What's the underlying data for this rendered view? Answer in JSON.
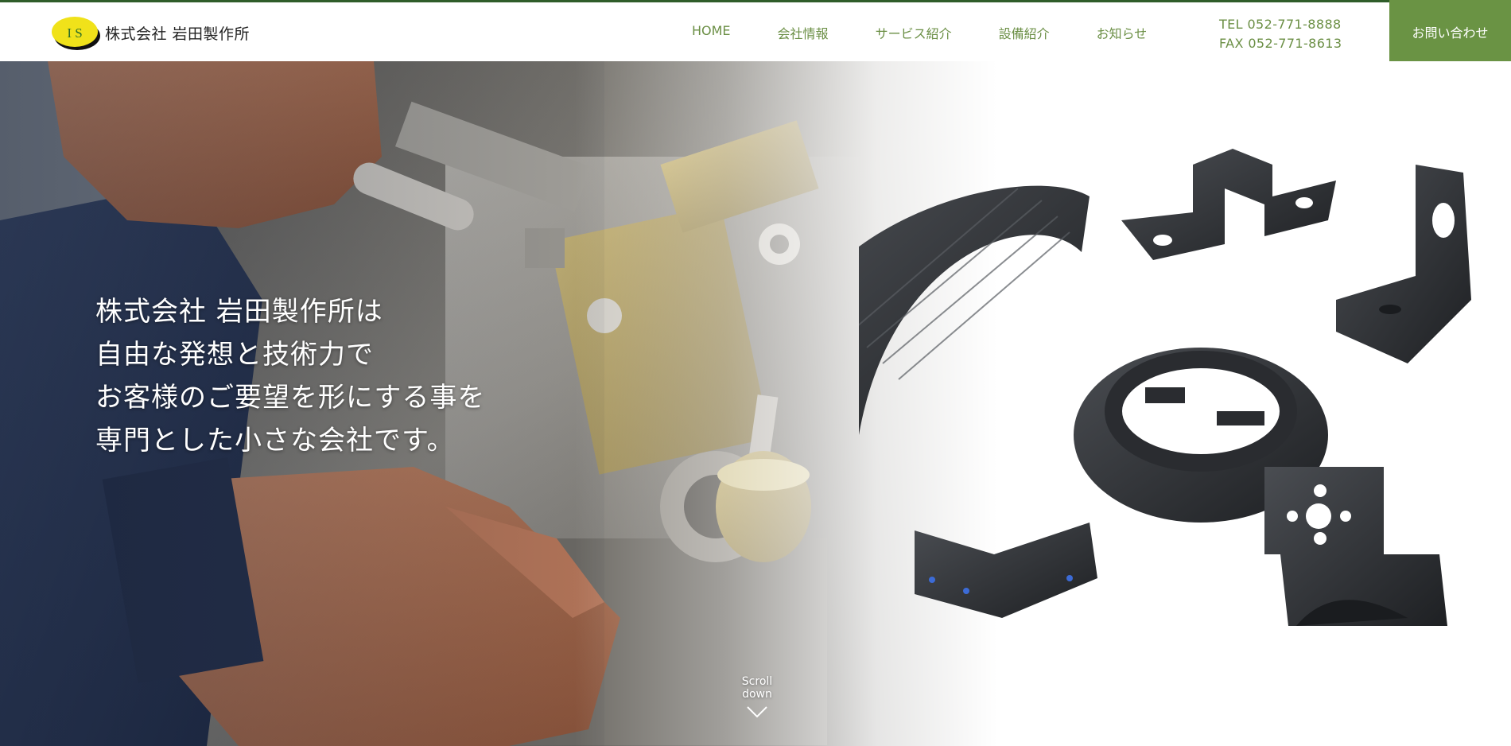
{
  "header": {
    "logo_letters": "I S",
    "company_name": "株式会社 岩田製作所",
    "nav": [
      {
        "label": "HOME"
      },
      {
        "label": "会社情報"
      },
      {
        "label": "サービス紹介"
      },
      {
        "label": "設備紹介"
      },
      {
        "label": "お知らせ"
      }
    ],
    "tel": "TEL 052-771-8888",
    "fax": "FAX 052-771-8613",
    "contact_label": "お問い合わせ"
  },
  "hero": {
    "tagline_lines": [
      "株式会社 岩田製作所は",
      "自由な発想と技術力で",
      "お客様のご要望を形にする事を",
      "専門とした小さな会社です。"
    ],
    "scroll_label": "Scroll down"
  },
  "colors": {
    "accent_green": "#6a9344",
    "nav_text": "#6b8f45",
    "top_border": "#2f5d2a",
    "logo_yellow": "#f0e21a"
  },
  "icons": [
    "logo-mark-icon",
    "chevron-down-icon"
  ]
}
